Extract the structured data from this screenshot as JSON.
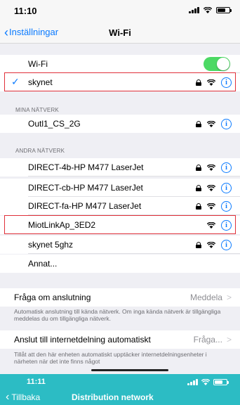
{
  "status_bar": {
    "time": "11:10"
  },
  "nav": {
    "back_label": "Inställningar",
    "title": "Wi-Fi"
  },
  "wifi_toggle": {
    "label": "Wi-Fi",
    "enabled": true
  },
  "connected": {
    "name": "skynet"
  },
  "my_networks": {
    "header": "MINA NÄTVERK",
    "items": [
      {
        "name": "Outl1_CS_2G"
      }
    ]
  },
  "other_networks": {
    "header": "ANDRA NÄTVERK",
    "items": [
      {
        "name": "DIRECT-4b-HP M477 LaserJet",
        "locked": true
      },
      {
        "name": "DIRECT-cb-HP M477 LaserJet",
        "locked": true
      },
      {
        "name": "DIRECT-fa-HP M477 LaserJet",
        "locked": true
      },
      {
        "name": "MiotLinkAp_3ED2",
        "locked": false
      },
      {
        "name": "skynet 5ghz",
        "locked": true
      },
      {
        "name": "Annat..."
      }
    ]
  },
  "ask_to_join": {
    "label": "Fråga om anslutning",
    "value": "Meddela",
    "footnote": "Automatisk anslutning till kända nätverk. Om inga kända nätverk är tillgängliga meddelas du om tillgängliga nätverk."
  },
  "hotspot": {
    "label": "Anslut till internetdelning automatiskt",
    "value": "Fråga...",
    "footnote": "Tillåt att den här enheten automatiskt upptäcker internetdelningsenheter i närheten när det inte finns något"
  },
  "second_screen": {
    "time": "11:11",
    "back_label": "Tillbaka",
    "title": "Distribution network"
  },
  "colors": {
    "accent": "#0a7aff",
    "toggle_on": "#4cd964",
    "highlight": "#e0303a",
    "second_bar": "#2cbcc4"
  }
}
